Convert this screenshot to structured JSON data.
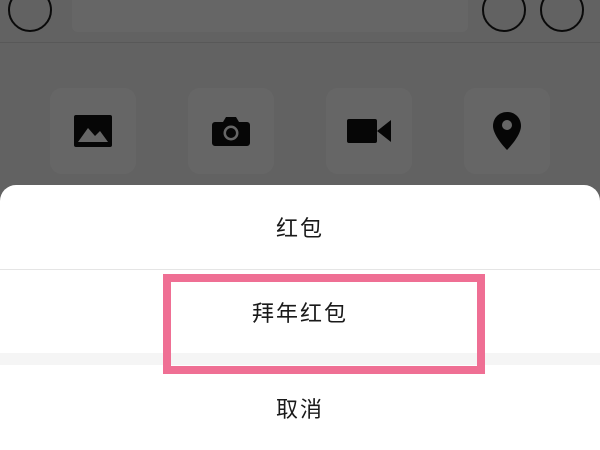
{
  "input_bar": {
    "voice_icon": "voice-icon",
    "emoji_icon": "emoji-icon",
    "plus_icon": "plus-icon"
  },
  "tools": [
    {
      "icon": "image-icon"
    },
    {
      "icon": "camera-icon"
    },
    {
      "icon": "video-icon"
    },
    {
      "icon": "location-icon"
    }
  ],
  "sheet": {
    "items": [
      {
        "label": "红包"
      },
      {
        "label": "拜年红包"
      }
    ],
    "cancel_label": "取消"
  },
  "colors": {
    "highlight": "#ef6f94",
    "overlay": "rgba(0,0,0,0.6)"
  }
}
